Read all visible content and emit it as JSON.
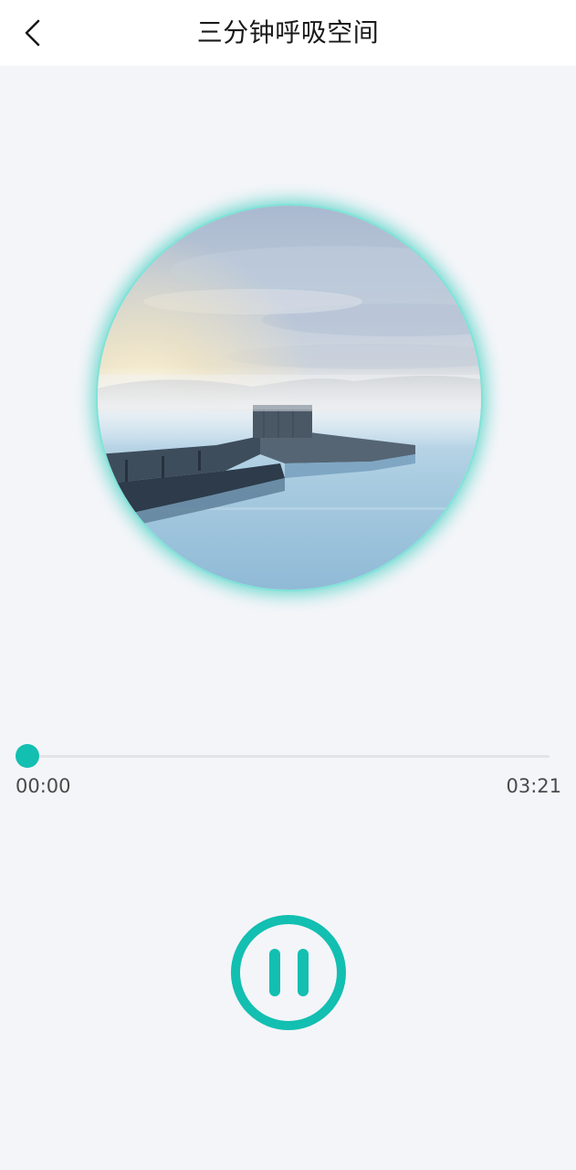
{
  "header": {
    "title": "三分钟呼吸空间",
    "back_icon": "chevron-left-icon"
  },
  "artwork": {
    "description_icon": "landscape-artwork",
    "glow_color": "#25c7b7"
  },
  "player": {
    "current_time": "00:00",
    "total_time": "03:21",
    "progress": 0,
    "state_icon": "pause-icon",
    "accent_color": "#12bfb1"
  }
}
